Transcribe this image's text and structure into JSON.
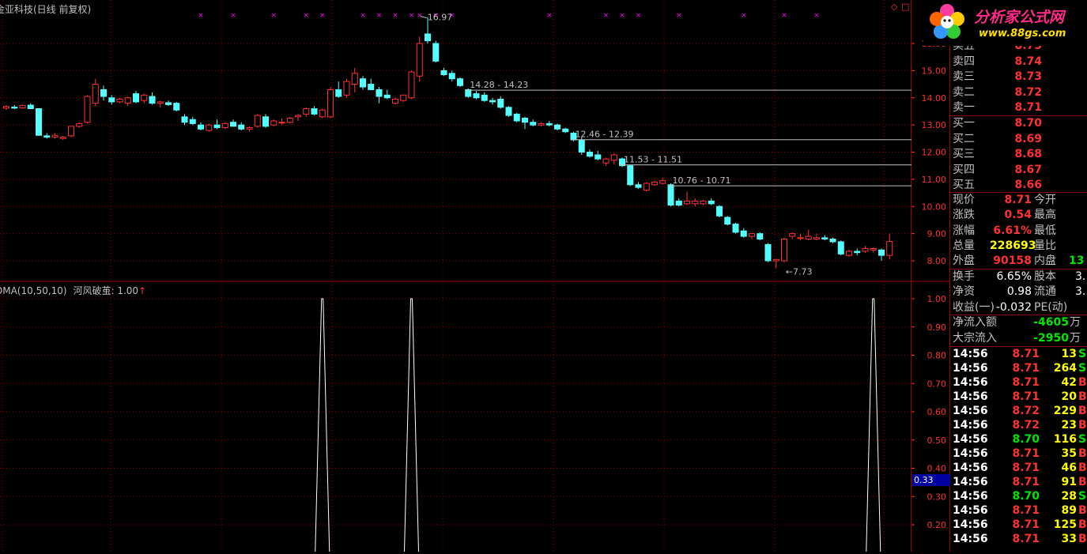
{
  "title": "金亚科技(日线 前复权)",
  "indicator": {
    "label": "DMA(10,50,10)",
    "name": "河风破茧",
    "value": "1.00",
    "marker": "↑"
  },
  "logo": {
    "name": "分析家公式网",
    "url": "www.88gs.com"
  },
  "price_axis": [
    "16.00",
    "15.00",
    "14.00",
    "13.00",
    "12.00",
    "11.00",
    "10.00",
    "9.00",
    "8.00"
  ],
  "ind_axis": [
    "1.00",
    "0.90",
    "0.80",
    "0.70",
    "0.60",
    "0.50",
    "0.40",
    "0.30",
    "0.20"
  ],
  "ind_cursor": "0.33",
  "annotations": [
    "16.97",
    "14.28 - 14.23",
    "12.46 - 12.39",
    "11.53 - 11.51",
    "10.76 - 10.71",
    "7.73"
  ],
  "colors": {
    "up": "#ff3232",
    "down": "#54ffff",
    "grid": "#8b0000",
    "marker": "#ff00ff"
  },
  "sells": [
    {
      "label": "卖五",
      "price": "8.75"
    },
    {
      "label": "卖四",
      "price": "8.74"
    },
    {
      "label": "卖三",
      "price": "8.73"
    },
    {
      "label": "卖二",
      "price": "8.72"
    },
    {
      "label": "卖一",
      "price": "8.71"
    }
  ],
  "buys": [
    {
      "label": "买一",
      "price": "8.70"
    },
    {
      "label": "买二",
      "price": "8.69"
    },
    {
      "label": "买三",
      "price": "8.68"
    },
    {
      "label": "买四",
      "price": "8.67"
    },
    {
      "label": "买五",
      "price": "8.66"
    }
  ],
  "quote": [
    {
      "l1": "现价",
      "v1": "8.71",
      "l2": "今开",
      "v2": ""
    },
    {
      "l1": "涨跌",
      "v1": "0.54",
      "l2": "最高",
      "v2": ""
    },
    {
      "l1": "涨幅",
      "v1": "6.61%",
      "l2": "最低",
      "v2": ""
    },
    {
      "l1": "总量",
      "v1": "228693",
      "l2": "量比",
      "v2": ""
    },
    {
      "l1": "外盘",
      "v1": "90158",
      "l2": "内盘",
      "v2": "13"
    }
  ],
  "fund": [
    {
      "l1": "换手",
      "v1": "6.65%",
      "l2": "股本",
      "v2": "3."
    },
    {
      "l1": "净资",
      "v1": "0.98",
      "l2": "流通",
      "v2": "3."
    },
    {
      "l1": "收益(一)",
      "v1": "-0.032",
      "l2": "PE(动)",
      "v2": ""
    }
  ],
  "flow": [
    {
      "label": "净流入额",
      "value": "-4605",
      "unit": "万"
    },
    {
      "label": "大宗流入",
      "value": "-2950",
      "unit": "万"
    }
  ],
  "ticks": [
    {
      "t": "14:56",
      "p": "8.71",
      "v": "13",
      "s": "S"
    },
    {
      "t": "14:56",
      "p": "8.71",
      "v": "264",
      "s": "S"
    },
    {
      "t": "14:56",
      "p": "8.71",
      "v": "42",
      "s": "B"
    },
    {
      "t": "14:56",
      "p": "8.71",
      "v": "20",
      "s": "B"
    },
    {
      "t": "14:56",
      "p": "8.72",
      "v": "229",
      "s": "B"
    },
    {
      "t": "14:56",
      "p": "8.72",
      "v": "23",
      "s": "B"
    },
    {
      "t": "14:56",
      "p": "8.70",
      "v": "116",
      "s": "S"
    },
    {
      "t": "14:56",
      "p": "8.71",
      "v": "35",
      "s": "B"
    },
    {
      "t": "14:56",
      "p": "8.71",
      "v": "46",
      "s": "B"
    },
    {
      "t": "14:56",
      "p": "8.71",
      "v": "91",
      "s": "B"
    },
    {
      "t": "14:56",
      "p": "8.70",
      "v": "28",
      "s": "S"
    },
    {
      "t": "14:56",
      "p": "8.71",
      "v": "89",
      "B": "",
      "s": "B"
    },
    {
      "t": "14:56",
      "p": "8.71",
      "v": "125",
      "s": "B"
    },
    {
      "t": "14:56",
      "p": "8.71",
      "v": "33",
      "s": "B"
    }
  ],
  "candles": [
    {
      "o": 13.62,
      "h": 13.72,
      "l": 13.55,
      "c": 13.68
    },
    {
      "o": 13.66,
      "h": 13.74,
      "l": 13.58,
      "c": 13.62
    },
    {
      "o": 13.63,
      "h": 13.75,
      "l": 13.6,
      "c": 13.72
    },
    {
      "o": 13.73,
      "h": 13.8,
      "l": 13.65,
      "c": 13.6
    },
    {
      "o": 13.6,
      "h": 13.62,
      "l": 12.6,
      "c": 12.62
    },
    {
      "o": 12.6,
      "h": 12.7,
      "l": 12.5,
      "c": 12.55
    },
    {
      "o": 12.55,
      "h": 12.7,
      "l": 12.5,
      "c": 12.62
    },
    {
      "o": 12.5,
      "h": 12.6,
      "l": 12.45,
      "c": 12.55
    },
    {
      "o": 12.6,
      "h": 12.95,
      "l": 12.55,
      "c": 12.95
    },
    {
      "o": 12.95,
      "h": 13.1,
      "l": 12.9,
      "c": 13.05
    },
    {
      "o": 13.1,
      "h": 14.1,
      "l": 13.05,
      "c": 14.05
    },
    {
      "o": 13.8,
      "h": 14.7,
      "l": 13.7,
      "c": 14.5
    },
    {
      "o": 14.3,
      "h": 14.45,
      "l": 13.9,
      "c": 14.05
    },
    {
      "o": 14.0,
      "h": 14.1,
      "l": 13.75,
      "c": 13.85
    },
    {
      "o": 13.85,
      "h": 14.0,
      "l": 13.8,
      "c": 13.95
    },
    {
      "o": 13.8,
      "h": 14.05,
      "l": 13.7,
      "c": 14.0
    },
    {
      "o": 14.15,
      "h": 14.25,
      "l": 13.8,
      "c": 13.85
    },
    {
      "o": 13.9,
      "h": 14.15,
      "l": 13.8,
      "c": 14.1
    },
    {
      "o": 14.05,
      "h": 14.2,
      "l": 13.75,
      "c": 13.8
    },
    {
      "o": 13.8,
      "h": 13.9,
      "l": 13.65,
      "c": 13.85
    },
    {
      "o": 13.82,
      "h": 13.9,
      "l": 13.7,
      "c": 13.75
    },
    {
      "o": 13.8,
      "h": 13.85,
      "l": 13.5,
      "c": 13.55
    },
    {
      "o": 13.3,
      "h": 13.4,
      "l": 13.0,
      "c": 13.1
    },
    {
      "o": 13.2,
      "h": 13.3,
      "l": 13.0,
      "c": 13.05
    },
    {
      "o": 13.0,
      "h": 13.1,
      "l": 12.8,
      "c": 12.85
    },
    {
      "o": 12.8,
      "h": 13.05,
      "l": 12.75,
      "c": 13.0
    },
    {
      "o": 13.0,
      "h": 13.2,
      "l": 12.85,
      "c": 12.9
    },
    {
      "o": 12.9,
      "h": 13.1,
      "l": 12.85,
      "c": 13.05
    },
    {
      "o": 13.1,
      "h": 13.2,
      "l": 12.95,
      "c": 12.95
    },
    {
      "o": 13.0,
      "h": 13.1,
      "l": 12.8,
      "c": 12.85
    },
    {
      "o": 12.85,
      "h": 12.95,
      "l": 12.75,
      "c": 12.9
    },
    {
      "o": 12.95,
      "h": 13.4,
      "l": 12.9,
      "c": 13.35
    },
    {
      "o": 13.3,
      "h": 13.4,
      "l": 12.9,
      "c": 12.95
    },
    {
      "o": 13.0,
      "h": 13.2,
      "l": 12.95,
      "c": 13.15
    },
    {
      "o": 13.1,
      "h": 13.25,
      "l": 13.0,
      "c": 13.1
    },
    {
      "o": 13.1,
      "h": 13.3,
      "l": 13.05,
      "c": 13.25
    },
    {
      "o": 13.3,
      "h": 13.4,
      "l": 13.15,
      "c": 13.35
    },
    {
      "o": 13.4,
      "h": 13.65,
      "l": 13.3,
      "c": 13.6
    },
    {
      "o": 13.6,
      "h": 13.7,
      "l": 13.35,
      "c": 13.4
    },
    {
      "o": 13.3,
      "h": 13.6,
      "l": 13.25,
      "c": 13.55
    },
    {
      "o": 13.3,
      "h": 14.4,
      "l": 13.25,
      "c": 14.3
    },
    {
      "o": 14.3,
      "h": 14.6,
      "l": 14.0,
      "c": 14.05
    },
    {
      "o": 14.1,
      "h": 14.7,
      "l": 14.0,
      "c": 14.6
    },
    {
      "o": 14.5,
      "h": 15.1,
      "l": 14.2,
      "c": 14.9
    },
    {
      "o": 14.7,
      "h": 14.8,
      "l": 14.3,
      "c": 14.4
    },
    {
      "o": 14.5,
      "h": 14.7,
      "l": 14.4,
      "c": 14.3
    },
    {
      "o": 14.3,
      "h": 14.4,
      "l": 13.8,
      "c": 14.05
    },
    {
      "o": 14.1,
      "h": 14.3,
      "l": 13.95,
      "c": 14.0
    },
    {
      "o": 13.8,
      "h": 14.0,
      "l": 13.75,
      "c": 13.95
    },
    {
      "o": 13.9,
      "h": 14.1,
      "l": 13.85,
      "c": 14.1
    },
    {
      "o": 14.0,
      "h": 15.0,
      "l": 13.95,
      "c": 14.95
    },
    {
      "o": 14.8,
      "h": 16.25,
      "l": 14.6,
      "c": 16.0
    },
    {
      "o": 16.35,
      "h": 16.97,
      "l": 16.0,
      "c": 16.1
    },
    {
      "o": 16.0,
      "h": 16.1,
      "l": 15.3,
      "c": 15.35
    },
    {
      "o": 15.0,
      "h": 15.1,
      "l": 14.8,
      "c": 14.85
    },
    {
      "o": 14.9,
      "h": 15.0,
      "l": 14.6,
      "c": 14.7
    },
    {
      "o": 14.7,
      "h": 14.75,
      "l": 14.4,
      "c": 14.45
    },
    {
      "o": 14.3,
      "h": 14.35,
      "l": 14.0,
      "c": 14.05
    },
    {
      "o": 14.15,
      "h": 14.25,
      "l": 13.95,
      "c": 14.0
    },
    {
      "o": 14.1,
      "h": 14.2,
      "l": 13.85,
      "c": 13.9
    },
    {
      "o": 13.9,
      "h": 14.0,
      "l": 13.75,
      "c": 13.85
    },
    {
      "o": 13.95,
      "h": 14.05,
      "l": 13.6,
      "c": 13.65
    },
    {
      "o": 13.65,
      "h": 13.7,
      "l": 13.3,
      "c": 13.35
    },
    {
      "o": 13.4,
      "h": 13.45,
      "l": 13.1,
      "c": 13.15
    },
    {
      "o": 13.25,
      "h": 13.3,
      "l": 12.85,
      "c": 13.1
    },
    {
      "o": 13.1,
      "h": 13.2,
      "l": 12.95,
      "c": 13.0
    },
    {
      "o": 13.0,
      "h": 13.1,
      "l": 12.95,
      "c": 13.05
    },
    {
      "o": 13.05,
      "h": 13.15,
      "l": 12.95,
      "c": 13.0
    },
    {
      "o": 13.0,
      "h": 13.05,
      "l": 12.8,
      "c": 12.85
    },
    {
      "o": 12.85,
      "h": 12.9,
      "l": 12.7,
      "c": 12.75
    },
    {
      "o": 12.7,
      "h": 12.75,
      "l": 12.4,
      "c": 12.45
    },
    {
      "o": 12.45,
      "h": 12.55,
      "l": 11.9,
      "c": 12.0
    },
    {
      "o": 12.0,
      "h": 12.1,
      "l": 11.8,
      "c": 11.85
    },
    {
      "o": 11.9,
      "h": 12.05,
      "l": 11.7,
      "c": 11.75
    },
    {
      "o": 11.6,
      "h": 11.8,
      "l": 11.5,
      "c": 11.75
    },
    {
      "o": 11.7,
      "h": 11.95,
      "l": 11.55,
      "c": 11.9
    },
    {
      "o": 11.75,
      "h": 11.8,
      "l": 11.45,
      "c": 11.5
    },
    {
      "o": 11.5,
      "h": 11.55,
      "l": 10.75,
      "c": 10.8
    },
    {
      "o": 10.8,
      "h": 10.9,
      "l": 10.65,
      "c": 10.7
    },
    {
      "o": 10.6,
      "h": 10.9,
      "l": 10.55,
      "c": 10.85
    },
    {
      "o": 10.8,
      "h": 10.95,
      "l": 10.75,
      "c": 10.9
    },
    {
      "o": 10.85,
      "h": 11.05,
      "l": 10.8,
      "c": 10.95
    },
    {
      "o": 10.8,
      "h": 10.85,
      "l": 10.0,
      "c": 10.05
    },
    {
      "o": 10.2,
      "h": 10.3,
      "l": 10.0,
      "c": 10.05
    },
    {
      "o": 10.1,
      "h": 10.55,
      "l": 10.05,
      "c": 10.2
    },
    {
      "o": 10.1,
      "h": 10.3,
      "l": 10.0,
      "c": 10.2
    },
    {
      "o": 10.1,
      "h": 10.25,
      "l": 10.05,
      "c": 10.2
    },
    {
      "o": 10.2,
      "h": 10.3,
      "l": 10.05,
      "c": 10.1
    },
    {
      "o": 10.0,
      "h": 10.05,
      "l": 9.6,
      "c": 9.65
    },
    {
      "o": 9.6,
      "h": 9.65,
      "l": 9.3,
      "c": 9.35
    },
    {
      "o": 9.35,
      "h": 9.4,
      "l": 9.0,
      "c": 9.05
    },
    {
      "o": 9.1,
      "h": 9.2,
      "l": 8.85,
      "c": 8.9
    },
    {
      "o": 8.9,
      "h": 9.0,
      "l": 8.8,
      "c": 9.0
    },
    {
      "o": 9.0,
      "h": 9.05,
      "l": 8.75,
      "c": 8.8
    },
    {
      "o": 8.6,
      "h": 8.65,
      "l": 7.95,
      "c": 8.0
    },
    {
      "o": 8.0,
      "h": 8.05,
      "l": 7.73,
      "c": 8.05
    },
    {
      "o": 8.0,
      "h": 8.85,
      "l": 7.95,
      "c": 8.8
    },
    {
      "o": 8.9,
      "h": 9.05,
      "l": 8.8,
      "c": 9.0
    },
    {
      "o": 8.85,
      "h": 9.0,
      "l": 8.75,
      "c": 8.85
    },
    {
      "o": 8.8,
      "h": 9.15,
      "l": 8.75,
      "c": 8.9
    },
    {
      "o": 8.8,
      "h": 9.0,
      "l": 8.75,
      "c": 8.85
    },
    {
      "o": 8.85,
      "h": 8.95,
      "l": 8.75,
      "c": 8.8
    },
    {
      "o": 8.8,
      "h": 8.85,
      "l": 8.65,
      "c": 8.7
    },
    {
      "o": 8.7,
      "h": 8.75,
      "l": 8.2,
      "c": 8.25
    },
    {
      "o": 8.2,
      "h": 8.4,
      "l": 8.15,
      "c": 8.35
    },
    {
      "o": 8.35,
      "h": 8.45,
      "l": 8.2,
      "c": 8.3
    },
    {
      "o": 8.35,
      "h": 8.55,
      "l": 8.3,
      "c": 8.45
    },
    {
      "o": 8.4,
      "h": 8.5,
      "l": 8.3,
      "c": 8.45
    },
    {
      "o": 8.4,
      "h": 8.45,
      "l": 8.0,
      "c": 8.2
    },
    {
      "o": 8.2,
      "h": 9.0,
      "l": 8.05,
      "c": 8.71
    }
  ],
  "x_markers": [
    24,
    28,
    33,
    37,
    39,
    44,
    46,
    48,
    50,
    51,
    53,
    55,
    67,
    74,
    76,
    78,
    83,
    91,
    96,
    100
  ],
  "spikes": [
    39,
    50,
    107
  ]
}
